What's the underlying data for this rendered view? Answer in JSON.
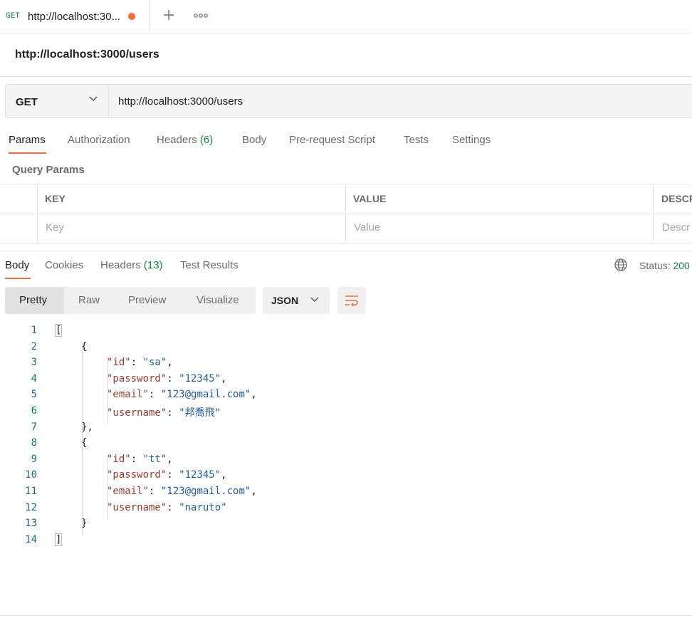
{
  "tab": {
    "method": "GET",
    "title": "http://localhost:30...",
    "unsaved_color": "#f26b3a"
  },
  "tabbar_icons": {
    "add": "plus-icon",
    "more": "more-horizontal-icon"
  },
  "request": {
    "title": "http://localhost:3000/users",
    "method": "GET",
    "url": "http://localhost:3000/users"
  },
  "request_tabs": [
    {
      "label": "Params",
      "count": ""
    },
    {
      "label": "Authorization",
      "count": ""
    },
    {
      "label": "Headers",
      "count": "(6)"
    },
    {
      "label": "Body",
      "count": ""
    },
    {
      "label": "Pre-request Script",
      "count": ""
    },
    {
      "label": "Tests",
      "count": ""
    },
    {
      "label": "Settings",
      "count": ""
    }
  ],
  "query_params": {
    "title": "Query Params",
    "columns": [
      "KEY",
      "VALUE",
      "DESCR"
    ],
    "placeholders": [
      "Key",
      "Value",
      "Descr"
    ]
  },
  "response": {
    "tabs": [
      {
        "label": "Body",
        "count": ""
      },
      {
        "label": "Cookies",
        "count": ""
      },
      {
        "label": "Headers",
        "count": "(13)"
      },
      {
        "label": "Test Results",
        "count": ""
      }
    ],
    "status_label": "Status:",
    "status_value": "200",
    "view_modes": [
      "Pretty",
      "Raw",
      "Preview",
      "Visualize"
    ],
    "format": "JSON"
  },
  "code_lines": [
    {
      "n": "1",
      "tokens": [
        [
          "pun",
          "["
        ]
      ],
      "indent": 0
    },
    {
      "n": "2",
      "tokens": [
        [
          "pun",
          "{"
        ]
      ],
      "indent": 1
    },
    {
      "n": "3",
      "tokens": [
        [
          "key",
          "\"id\""
        ],
        [
          "pun",
          ": "
        ],
        [
          "str",
          "\"sa\""
        ],
        [
          "pun",
          ","
        ]
      ],
      "indent": 2
    },
    {
      "n": "4",
      "tokens": [
        [
          "key",
          "\"password\""
        ],
        [
          "pun",
          ": "
        ],
        [
          "str",
          "\"12345\""
        ],
        [
          "pun",
          ","
        ]
      ],
      "indent": 2
    },
    {
      "n": "5",
      "tokens": [
        [
          "key",
          "\"email\""
        ],
        [
          "pun",
          ": "
        ],
        [
          "str",
          "\"123@gmail.com\""
        ],
        [
          "pun",
          ","
        ]
      ],
      "indent": 2
    },
    {
      "n": "6",
      "tokens": [
        [
          "key",
          "\"username\""
        ],
        [
          "pun",
          ": "
        ],
        [
          "str",
          "\"邦喬飛\""
        ]
      ],
      "indent": 2
    },
    {
      "n": "7",
      "tokens": [
        [
          "pun",
          "},"
        ]
      ],
      "indent": 1
    },
    {
      "n": "8",
      "tokens": [
        [
          "pun",
          "{"
        ]
      ],
      "indent": 1
    },
    {
      "n": "9",
      "tokens": [
        [
          "key",
          "\"id\""
        ],
        [
          "pun",
          ": "
        ],
        [
          "str",
          "\"tt\""
        ],
        [
          "pun",
          ","
        ]
      ],
      "indent": 2
    },
    {
      "n": "10",
      "tokens": [
        [
          "key",
          "\"password\""
        ],
        [
          "pun",
          ": "
        ],
        [
          "str",
          "\"12345\""
        ],
        [
          "pun",
          ","
        ]
      ],
      "indent": 2
    },
    {
      "n": "11",
      "tokens": [
        [
          "key",
          "\"email\""
        ],
        [
          "pun",
          ": "
        ],
        [
          "str",
          "\"123@gmail.com\""
        ],
        [
          "pun",
          ","
        ]
      ],
      "indent": 2
    },
    {
      "n": "12",
      "tokens": [
        [
          "key",
          "\"username\""
        ],
        [
          "pun",
          ": "
        ],
        [
          "str",
          "\"naruto\""
        ]
      ],
      "indent": 2
    },
    {
      "n": "13",
      "tokens": [
        [
          "pun",
          "}"
        ]
      ],
      "indent": 1
    },
    {
      "n": "14",
      "tokens": [
        [
          "pun",
          "]"
        ]
      ],
      "indent": 0
    }
  ]
}
